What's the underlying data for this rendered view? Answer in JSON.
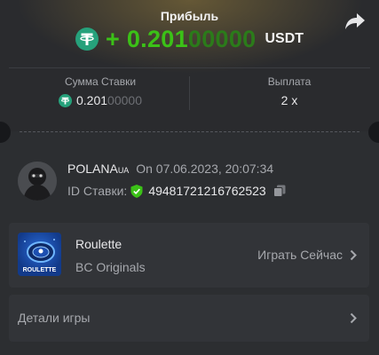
{
  "header": {
    "title": "Прибыль",
    "profit_sign": "+",
    "profit_main": "0.201",
    "profit_tail": "00000",
    "currency": "USDT",
    "share_icon": "share-icon",
    "accent_color": "#3bc117"
  },
  "stats": {
    "amount_label": "Сумма Ставки",
    "amount_main": "0.201",
    "amount_tail": "00000",
    "payout_label": "Выплата",
    "payout_value": "2 x"
  },
  "bet": {
    "user_name": "POLANA",
    "user_badge": "UA",
    "on_prefix": "On",
    "timestamp": "07.06.2023, 20:07:34",
    "id_label": "ID Ставки:",
    "id_value": "49481721216762523",
    "verified_icon": "shield-check-icon",
    "copy_icon": "copy-icon"
  },
  "game": {
    "name": "Roulette",
    "provider": "BC Originals",
    "play_label": "Играть Сейчас",
    "thumb_text": "ROULETTE"
  },
  "details": {
    "label": "Детали игры"
  }
}
